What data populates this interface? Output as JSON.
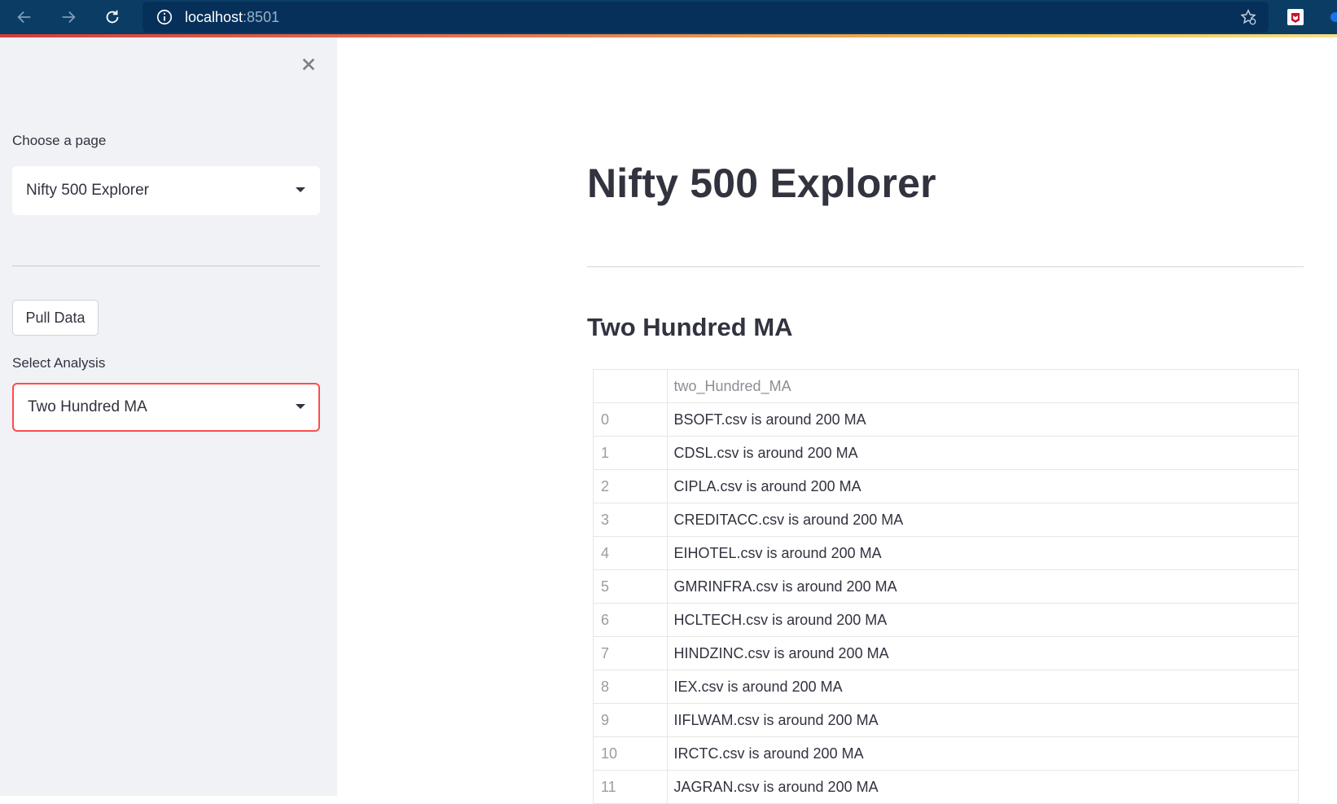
{
  "browser": {
    "url_host": "localhost",
    "url_port": ":8501"
  },
  "sidebar": {
    "page_label": "Choose a page",
    "page_selected": "Nifty 500 Explorer",
    "pull_button": "Pull Data",
    "analysis_label": "Select Analysis",
    "analysis_selected": "Two Hundred MA"
  },
  "main": {
    "title": "Nifty 500 Explorer",
    "subtitle": "Two Hundred MA",
    "table": {
      "column": "two_Hundred_MA",
      "rows": [
        {
          "idx": "0",
          "value": "BSOFT.csv is around 200 MA"
        },
        {
          "idx": "1",
          "value": "CDSL.csv is around 200 MA"
        },
        {
          "idx": "2",
          "value": "CIPLA.csv is around 200 MA"
        },
        {
          "idx": "3",
          "value": "CREDITACC.csv is around 200 MA"
        },
        {
          "idx": "4",
          "value": "EIHOTEL.csv is around 200 MA"
        },
        {
          "idx": "5",
          "value": "GMRINFRA.csv is around 200 MA"
        },
        {
          "idx": "6",
          "value": "HCLTECH.csv is around 200 MA"
        },
        {
          "idx": "7",
          "value": "HINDZINC.csv is around 200 MA"
        },
        {
          "idx": "8",
          "value": "IEX.csv is around 200 MA"
        },
        {
          "idx": "9",
          "value": "IIFLWAM.csv is around 200 MA"
        },
        {
          "idx": "10",
          "value": "IRCTC.csv is around 200 MA"
        },
        {
          "idx": "11",
          "value": "JAGRAN.csv is around 200 MA"
        }
      ]
    }
  },
  "colors": {
    "browser_bar": "#0b3d64",
    "sidebar_bg": "#f0f2f6",
    "focus_border": "#ff4b4b",
    "text": "#31333f"
  },
  "icons": [
    "back-arrow-icon",
    "forward-arrow-icon",
    "reload-icon",
    "info-icon",
    "bookmark-star-icon",
    "extension-icon",
    "close-icon",
    "chevron-down-icon"
  ]
}
